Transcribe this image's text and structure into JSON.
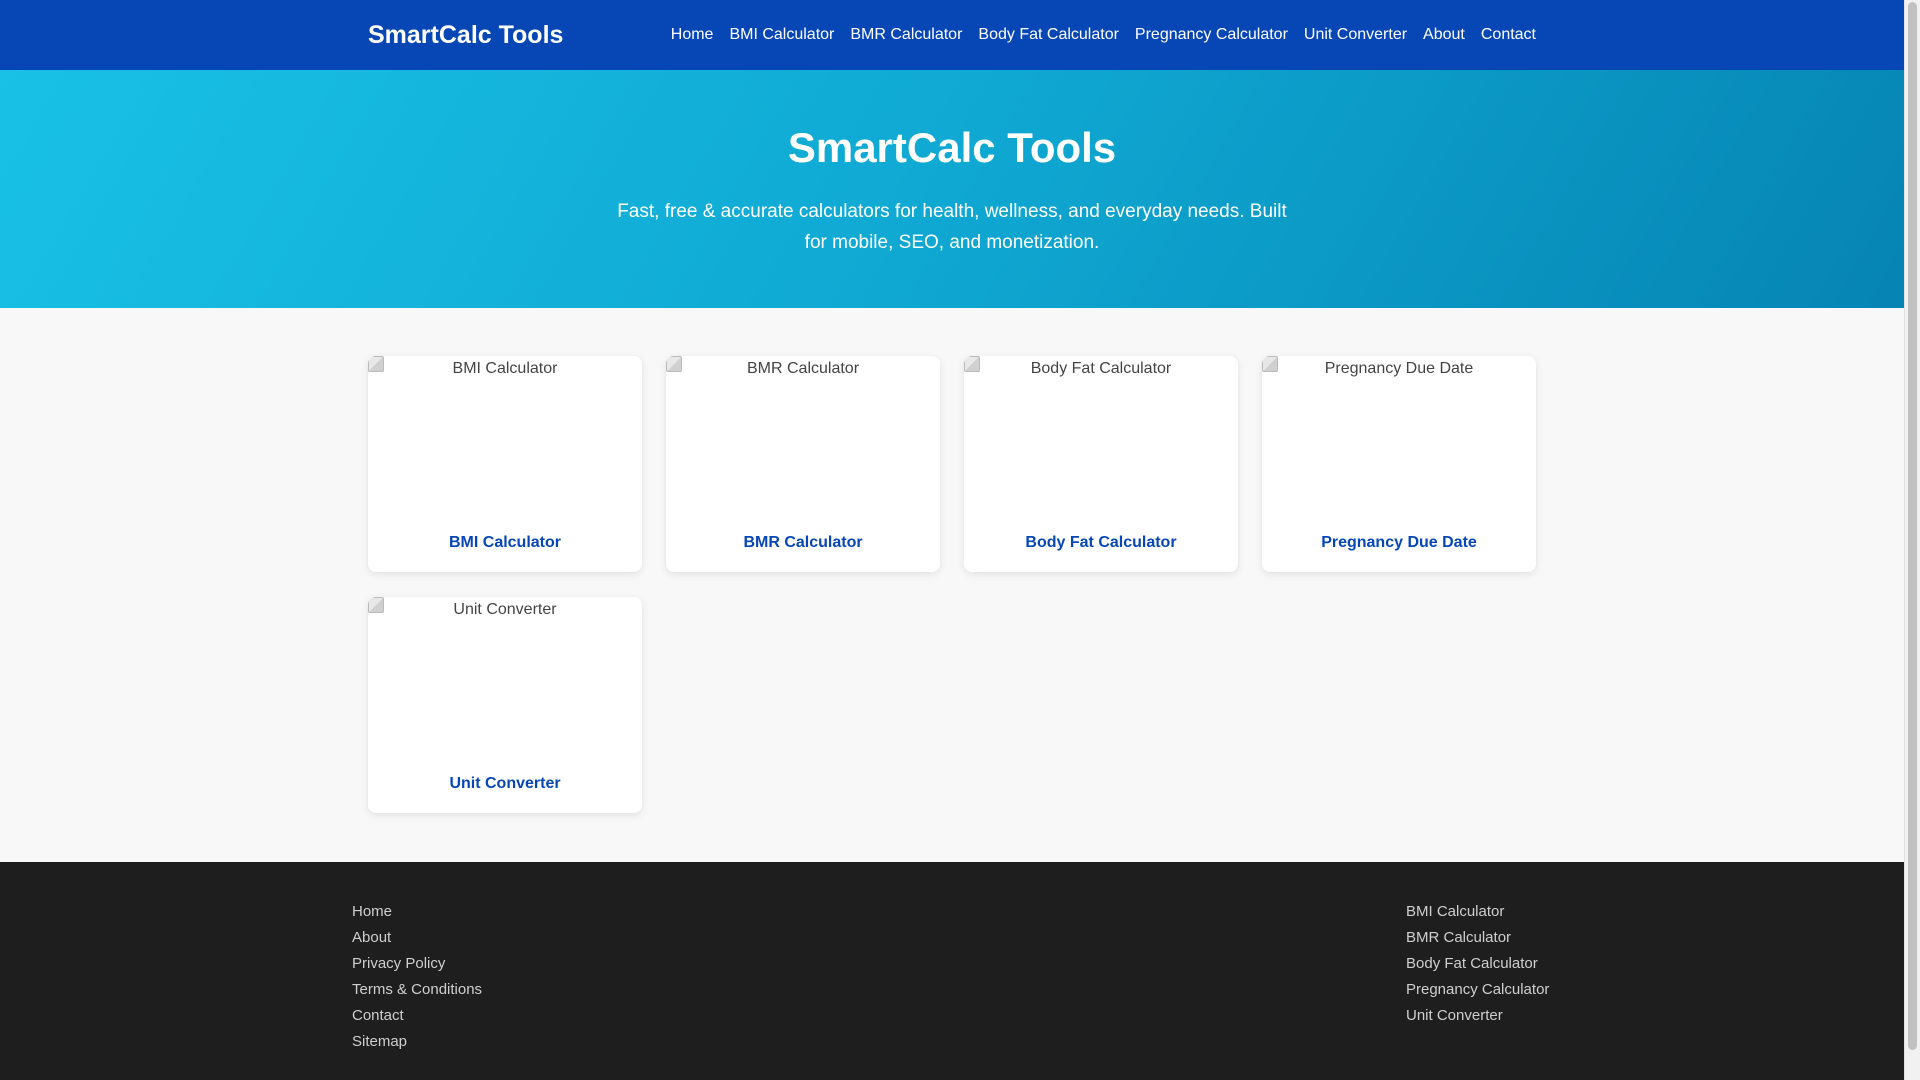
{
  "header": {
    "brand": "SmartCalc Tools",
    "nav": [
      "Home",
      "BMI Calculator",
      "BMR Calculator",
      "Body Fat Calculator",
      "Pregnancy Calculator",
      "Unit Converter",
      "About",
      "Contact"
    ]
  },
  "hero": {
    "title": "SmartCalc Tools",
    "tagline": "Fast, free & accurate calculators for health, wellness, and everyday needs. Built for mobile, SEO, and monetization."
  },
  "cards": [
    {
      "img_alt": "BMI Calculator",
      "title": "BMI Calculator"
    },
    {
      "img_alt": "BMR Calculator",
      "title": "BMR Calculator"
    },
    {
      "img_alt": "Body Fat Calculator",
      "title": "Body Fat Calculator"
    },
    {
      "img_alt": "Pregnancy Due Date",
      "title": "Pregnancy Due Date"
    },
    {
      "img_alt": "Unit Converter",
      "title": "Unit Converter"
    }
  ],
  "footer": {
    "left_links": [
      "Home",
      "About",
      "Privacy Policy",
      "Terms & Conditions",
      "Contact",
      "Sitemap"
    ],
    "right_links": [
      "BMI Calculator",
      "BMR Calculator",
      "Body Fat Calculator",
      "Pregnancy Calculator",
      "Unit Converter"
    ]
  },
  "colors": {
    "header_bg": "#0747b5",
    "accent": "#0747b5",
    "footer_bg": "#1e1e1e"
  }
}
